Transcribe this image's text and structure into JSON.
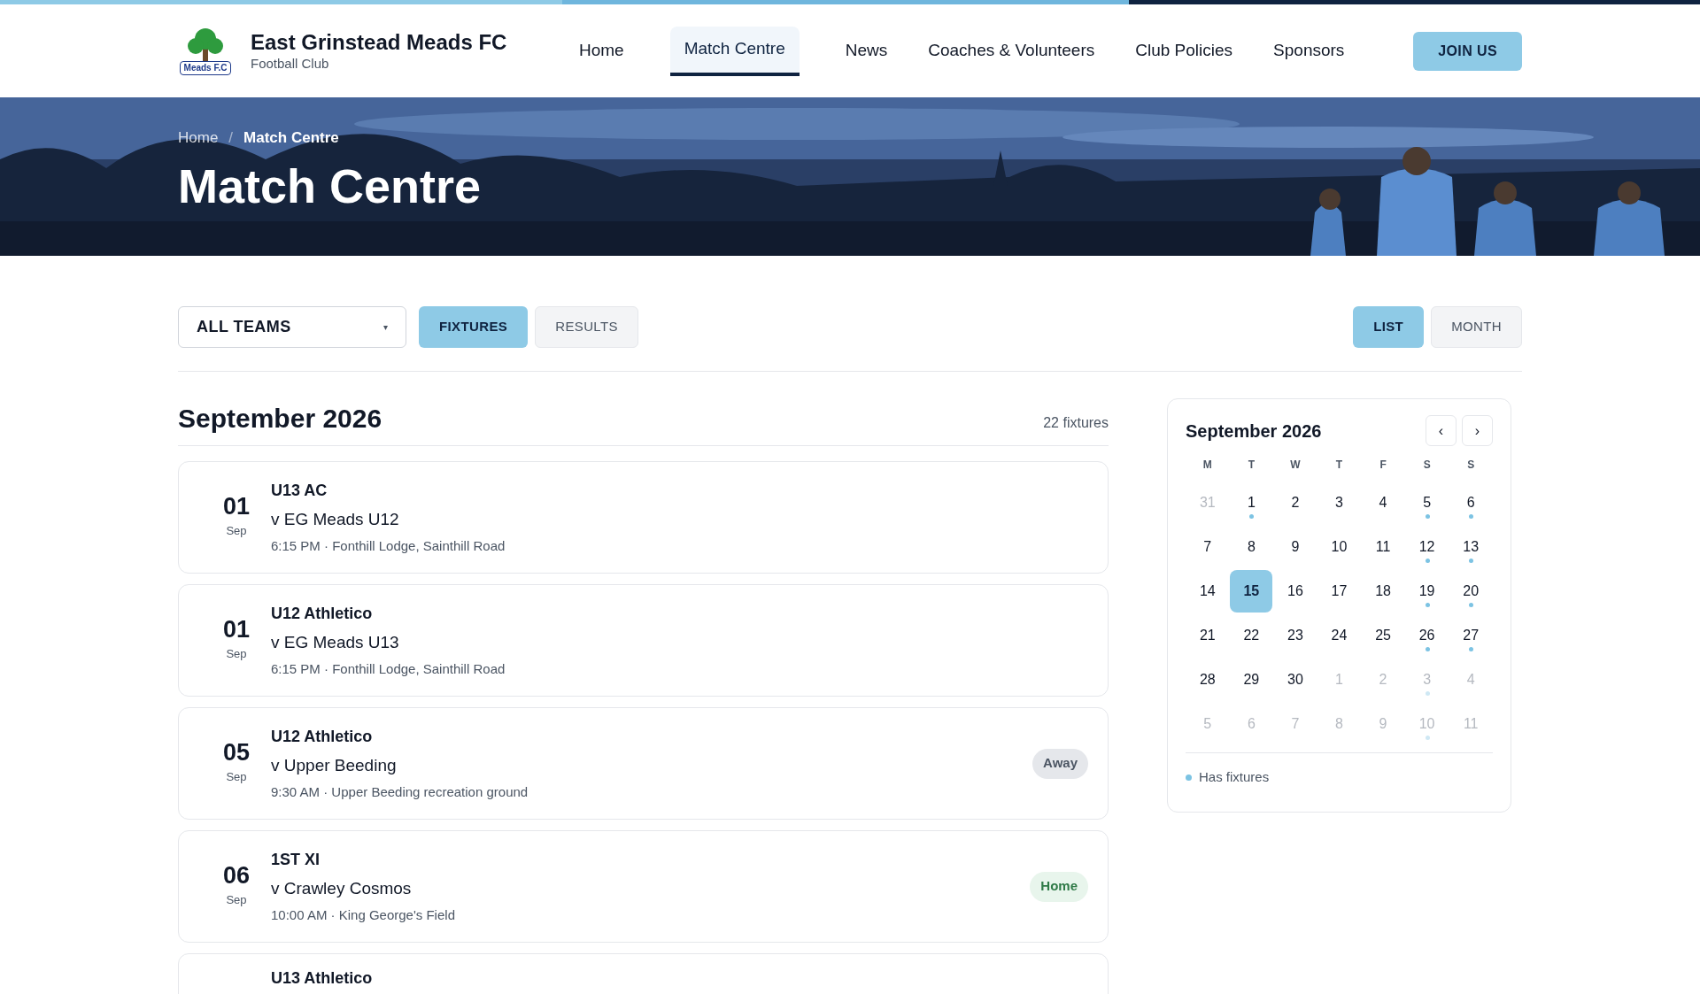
{
  "site": {
    "name": "East Grinstead Meads FC",
    "tagline": "Football Club",
    "logo_text": "Meads F.C"
  },
  "nav": [
    {
      "label": "Home",
      "selected": false
    },
    {
      "label": "Match Centre",
      "selected": true
    },
    {
      "label": "News",
      "selected": false
    },
    {
      "label": "Coaches & Volunteers",
      "selected": false
    },
    {
      "label": "Club Policies",
      "selected": false
    },
    {
      "label": "Sponsors",
      "selected": false
    }
  ],
  "join_button": "JOIN US",
  "breadcrumb": [
    {
      "label": "Home",
      "current": false
    },
    {
      "label": "Match Centre",
      "current": true
    }
  ],
  "breadcrumb_separator": "/",
  "page_title": "Match Centre",
  "team_filter": {
    "value": "ALL TEAMS",
    "caret": "▾"
  },
  "type_tabs": [
    {
      "label": "FIXTURES",
      "selected": true
    },
    {
      "label": "RESULTS",
      "selected": false
    }
  ],
  "view_tabs": [
    {
      "label": "LIST",
      "selected": true
    },
    {
      "label": "MONTH",
      "selected": false
    }
  ],
  "month_heading": "September 2026",
  "fixture_count": "22 fixtures",
  "fixtures": [
    {
      "day": "01",
      "month": "Sep",
      "team": "U13 AC",
      "opponent": "v EG Meads U12",
      "details": "6:15 PM · Fonthill Lodge, Sainthill Road"
    },
    {
      "day": "01",
      "month": "Sep",
      "team": "U12 Athletico",
      "opponent": "v EG Meads U13",
      "details": "6:15 PM · Fonthill Lodge, Sainthill Road"
    },
    {
      "day": "05",
      "month": "Sep",
      "team": "U12 Athletico",
      "opponent": "v Upper Beeding",
      "details": "9:30 AM · Upper Beeding recreation ground",
      "venue": {
        "kind": "away",
        "label": "Away"
      }
    },
    {
      "day": "06",
      "month": "Sep",
      "team": "1ST XI",
      "opponent": "v Crawley Cosmos",
      "details": "10:00 AM · King George's Field",
      "venue": {
        "kind": "home",
        "label": "Home"
      }
    },
    {
      "team": "U13 Athletico"
    }
  ],
  "calendar": {
    "title": "September 2026",
    "prev": "‹",
    "next": "›",
    "weekdays": [
      "M",
      "T",
      "W",
      "T",
      "F",
      "S",
      "S"
    ],
    "days": [
      {
        "label": "31",
        "outside": true,
        "has_fixtures": false,
        "selected": false
      },
      {
        "label": "1",
        "outside": false,
        "has_fixtures": true,
        "selected": false
      },
      {
        "label": "2",
        "outside": false,
        "has_fixtures": false,
        "selected": false
      },
      {
        "label": "3",
        "outside": false,
        "has_fixtures": false,
        "selected": false
      },
      {
        "label": "4",
        "outside": false,
        "has_fixtures": false,
        "selected": false
      },
      {
        "label": "5",
        "outside": false,
        "has_fixtures": true,
        "selected": false
      },
      {
        "label": "6",
        "outside": false,
        "has_fixtures": true,
        "selected": false
      },
      {
        "label": "7",
        "outside": false,
        "has_fixtures": false,
        "selected": false
      },
      {
        "label": "8",
        "outside": false,
        "has_fixtures": false,
        "selected": false
      },
      {
        "label": "9",
        "outside": false,
        "has_fixtures": false,
        "selected": false
      },
      {
        "label": "10",
        "outside": false,
        "has_fixtures": false,
        "selected": false
      },
      {
        "label": "11",
        "outside": false,
        "has_fixtures": false,
        "selected": false
      },
      {
        "label": "12",
        "outside": false,
        "has_fixtures": true,
        "selected": false
      },
      {
        "label": "13",
        "outside": false,
        "has_fixtures": true,
        "selected": false
      },
      {
        "label": "14",
        "outside": false,
        "has_fixtures": false,
        "selected": false
      },
      {
        "label": "15",
        "outside": false,
        "has_fixtures": false,
        "selected": true
      },
      {
        "label": "16",
        "outside": false,
        "has_fixtures": false,
        "selected": false
      },
      {
        "label": "17",
        "outside": false,
        "has_fixtures": false,
        "selected": false
      },
      {
        "label": "18",
        "outside": false,
        "has_fixtures": false,
        "selected": false
      },
      {
        "label": "19",
        "outside": false,
        "has_fixtures": true,
        "selected": false
      },
      {
        "label": "20",
        "outside": false,
        "has_fixtures": true,
        "selected": false
      },
      {
        "label": "21",
        "outside": false,
        "has_fixtures": false,
        "selected": false
      },
      {
        "label": "22",
        "outside": false,
        "has_fixtures": false,
        "selected": false
      },
      {
        "label": "23",
        "outside": false,
        "has_fixtures": false,
        "selected": false
      },
      {
        "label": "24",
        "outside": false,
        "has_fixtures": false,
        "selected": false
      },
      {
        "label": "25",
        "outside": false,
        "has_fixtures": false,
        "selected": false
      },
      {
        "label": "26",
        "outside": false,
        "has_fixtures": true,
        "selected": false
      },
      {
        "label": "27",
        "outside": false,
        "has_fixtures": true,
        "selected": false
      },
      {
        "label": "28",
        "outside": false,
        "has_fixtures": false,
        "selected": false
      },
      {
        "label": "29",
        "outside": false,
        "has_fixtures": false,
        "selected": false
      },
      {
        "label": "30",
        "outside": false,
        "has_fixtures": false,
        "selected": false
      },
      {
        "label": "1",
        "outside": true,
        "has_fixtures": false,
        "selected": false
      },
      {
        "label": "2",
        "outside": true,
        "has_fixtures": false,
        "selected": false
      },
      {
        "label": "3",
        "outside": true,
        "has_fixtures": true,
        "selected": false
      },
      {
        "label": "4",
        "outside": true,
        "has_fixtures": false,
        "selected": false
      },
      {
        "label": "5",
        "outside": true,
        "has_fixtures": false,
        "selected": false
      },
      {
        "label": "6",
        "outside": true,
        "has_fixtures": false,
        "selected": false
      },
      {
        "label": "7",
        "outside": true,
        "has_fixtures": false,
        "selected": false
      },
      {
        "label": "8",
        "outside": true,
        "has_fixtures": false,
        "selected": false
      },
      {
        "label": "9",
        "outside": true,
        "has_fixtures": false,
        "selected": false
      },
      {
        "label": "10",
        "outside": true,
        "has_fixtures": true,
        "selected": false
      },
      {
        "label": "11",
        "outside": true,
        "has_fixtures": false,
        "selected": false
      }
    ],
    "legend": "Has fixtures"
  }
}
